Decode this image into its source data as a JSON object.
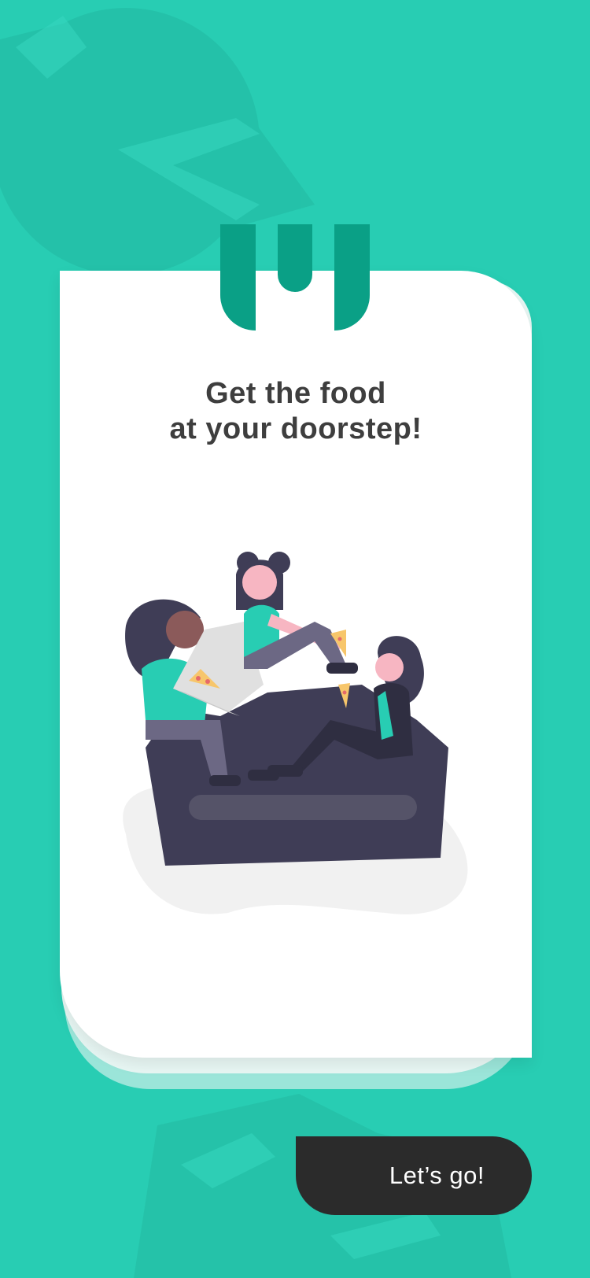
{
  "colors": {
    "background": "#28CDB3",
    "accent": "#0AA086",
    "card": "#FFFFFF",
    "button": "#2B2B2B",
    "text": "#3E3E3E"
  },
  "brand": {
    "logo_icon": "brand-logo-icon"
  },
  "onboarding": {
    "headline_line1": "Get the food",
    "headline_line2": "at your doorstep!",
    "illustration": "friends-eating-pizza-illustration"
  },
  "cta": {
    "label": "Let’s go!"
  }
}
